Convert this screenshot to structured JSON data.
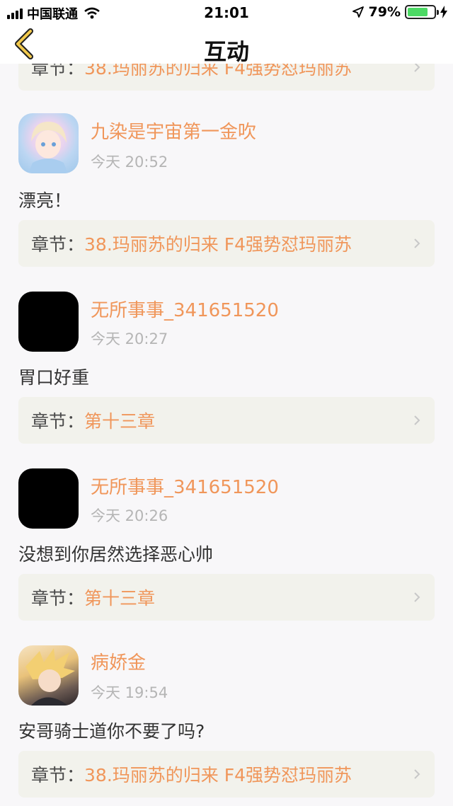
{
  "status_bar": {
    "carrier": "中国联通",
    "time": "21:01",
    "battery": "79%",
    "battery_level": 0.79
  },
  "nav": {
    "title": "互动",
    "back_icon": "chevron-left-icon"
  },
  "chapter_prefix": "章节：",
  "top_partial_chapter": "38.玛丽苏的归来 F4强势怼玛丽苏",
  "comments": [
    {
      "username": "九染是宇宙第一金吹",
      "time": "今天 20:52",
      "text": "漂亮！",
      "chapter": "38.玛丽苏的归来 F4强势怼玛丽苏",
      "avatar_style": "anime-blue"
    },
    {
      "username": "无所事事_341651520",
      "time": "今天 20:27",
      "text": "胃口好重",
      "chapter": "第十三章",
      "avatar_style": "black"
    },
    {
      "username": "无所事事_341651520",
      "time": "今天 20:26",
      "text": "没想到你居然选择恶心帅",
      "chapter": "第十三章",
      "avatar_style": "black"
    },
    {
      "username": "病娇金",
      "time": "今天 19:54",
      "text": "安哥骑士道你不要了吗?",
      "chapter": "38.玛丽苏的归来 F4强势怼玛丽苏",
      "avatar_style": "anime-gold"
    }
  ],
  "colors": {
    "accent": "#f0965a",
    "chapter_bg": "#f2f2ec",
    "page_bg": "#f8f7f9",
    "time_gray": "#b5b5b5"
  }
}
